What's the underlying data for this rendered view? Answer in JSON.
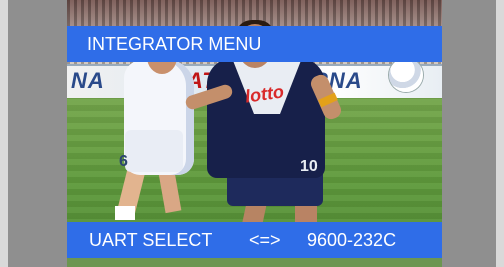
{
  "osd": {
    "title": "INTEGRATOR MENU",
    "setting_label": "UART SELECT",
    "setting_arrow": "<=>",
    "setting_value": "9600-232C",
    "bar_color": "#2f6de8"
  },
  "video": {
    "ad_board": [
      "NA",
      "ATOTA",
      "RNA"
    ],
    "jersey_sponsor": "lotto",
    "jersey_numbers": [
      "6",
      "10"
    ]
  }
}
